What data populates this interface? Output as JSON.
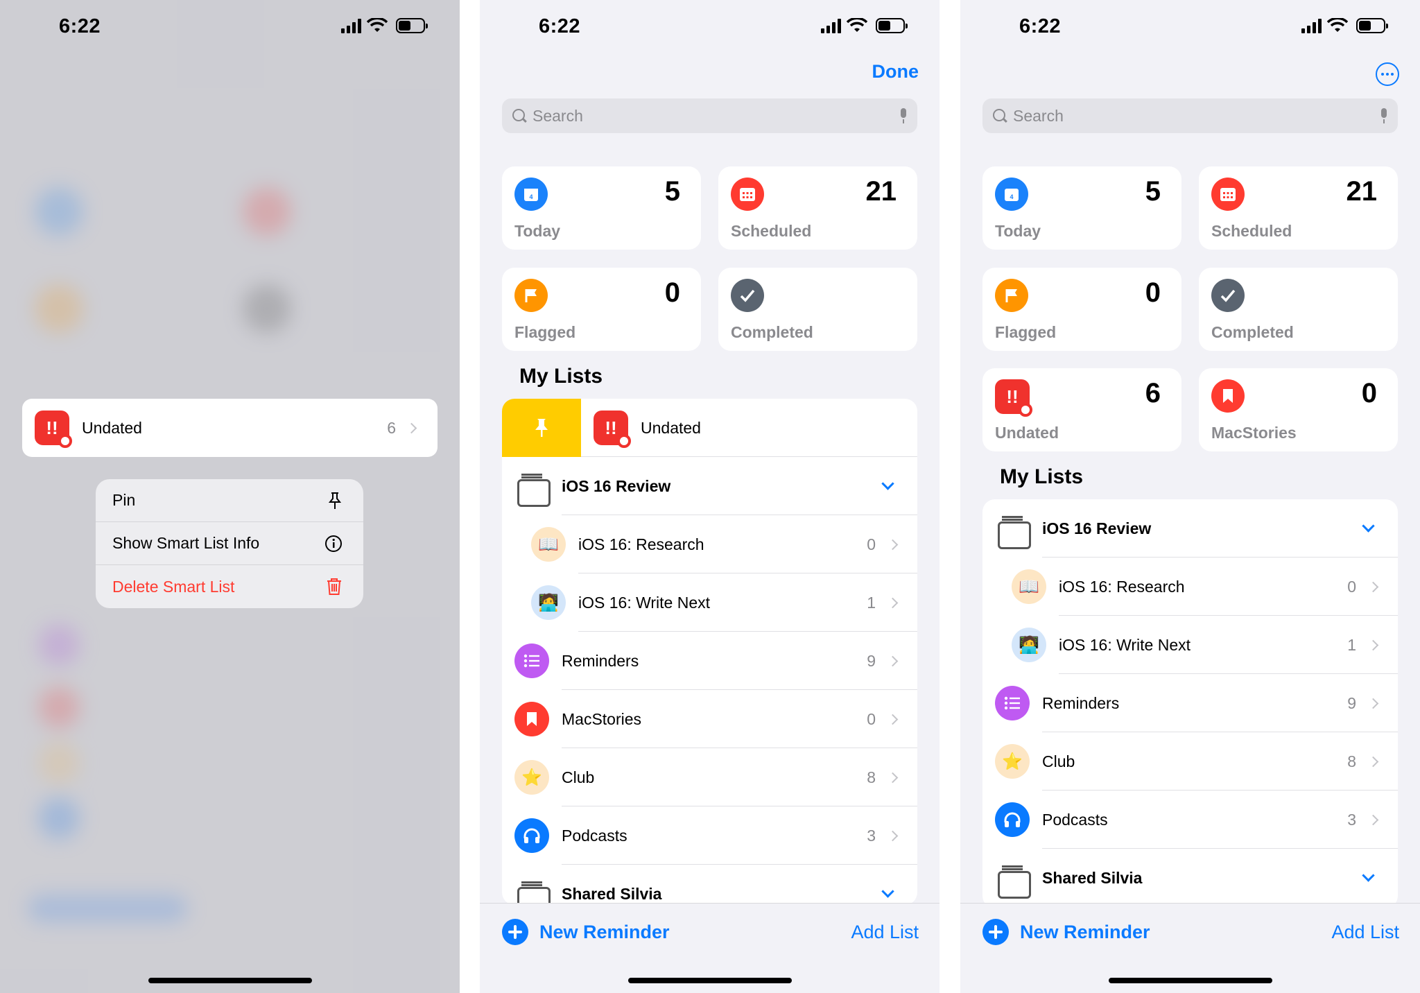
{
  "status": {
    "time": "6:22"
  },
  "colors": {
    "accent": "#0a7aff",
    "red": "#ff3b30",
    "yellow": "#ffcc00"
  },
  "panel1": {
    "row": {
      "icon": "undated-smartlist-icon",
      "label": "Undated",
      "count": "6"
    },
    "menu": [
      {
        "label": "Pin",
        "icon": "pin-icon"
      },
      {
        "label": "Show Smart List Info",
        "icon": "info-icon"
      },
      {
        "label": "Delete Smart List",
        "icon": "trash-icon",
        "destructive": true
      }
    ]
  },
  "panel2": {
    "done": "Done",
    "search_placeholder": "Search",
    "cards": [
      {
        "label": "Today",
        "count": "5",
        "color": "#1a82fb",
        "icon": "calendar-icon"
      },
      {
        "label": "Scheduled",
        "count": "21",
        "color": "#ff3b30",
        "icon": "calendar-grid-icon"
      },
      {
        "label": "Flagged",
        "count": "0",
        "color": "#ff9500",
        "icon": "flag-icon"
      },
      {
        "label": "Completed",
        "count": "",
        "color": "#5a6470",
        "icon": "checkmark-icon"
      }
    ],
    "section": "My Lists",
    "pinned": {
      "label": "Undated"
    },
    "lists": [
      {
        "label": "iOS 16 Review",
        "type": "group"
      },
      {
        "label": "iOS 16: Research",
        "count": "0",
        "type": "sub",
        "emoji": "📖"
      },
      {
        "label": "iOS 16: Write Next",
        "count": "1",
        "type": "sub",
        "emoji": "🧑‍💻"
      },
      {
        "label": "Reminders",
        "count": "9",
        "color": "#bf5af2",
        "icon": "list-icon"
      },
      {
        "label": "MacStories",
        "count": "0",
        "color": "#ff3b30",
        "icon": "bookmark-icon"
      },
      {
        "label": "Club",
        "count": "8",
        "emoji": "⭐"
      },
      {
        "label": "Podcasts",
        "count": "3",
        "color": "#0a7aff",
        "icon": "headphones-icon"
      },
      {
        "label": "Shared Silvia",
        "type": "group"
      }
    ],
    "new_reminder": "New Reminder",
    "add_list": "Add List"
  },
  "panel3": {
    "search_placeholder": "Search",
    "cards": [
      {
        "label": "Today",
        "count": "5"
      },
      {
        "label": "Scheduled",
        "count": "21"
      },
      {
        "label": "Flagged",
        "count": "0"
      },
      {
        "label": "Completed",
        "count": ""
      },
      {
        "label": "Undated",
        "count": "6"
      },
      {
        "label": "MacStories",
        "count": "0"
      }
    ],
    "section": "My Lists",
    "lists": [
      {
        "label": "iOS 16 Review"
      },
      {
        "label": "iOS 16: Research",
        "count": "0"
      },
      {
        "label": "iOS 16: Write Next",
        "count": "1"
      },
      {
        "label": "Reminders",
        "count": "9"
      },
      {
        "label": "Club",
        "count": "8"
      },
      {
        "label": "Podcasts",
        "count": "3"
      },
      {
        "label": "Shared Silvia"
      }
    ],
    "new_reminder": "New Reminder",
    "add_list": "Add List"
  }
}
